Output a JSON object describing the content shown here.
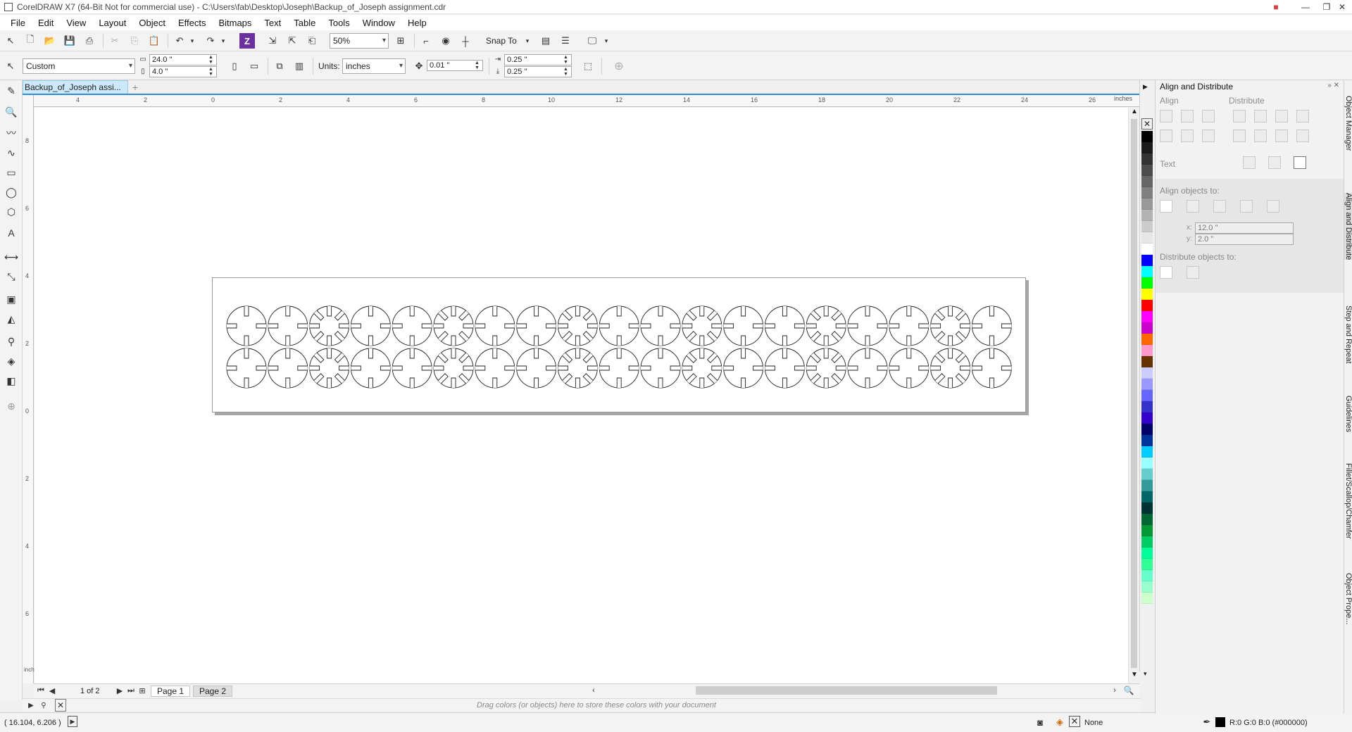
{
  "window": {
    "title": "CorelDRAW X7 (64-Bit Not for commercial use) - C:\\Users\\fab\\Desktop\\Joseph\\Backup_of_Joseph assignment.cdr",
    "minimize": "—",
    "maximize": "❐",
    "close": "✕"
  },
  "menu": [
    "File",
    "Edit",
    "View",
    "Layout",
    "Object",
    "Effects",
    "Bitmaps",
    "Text",
    "Table",
    "Tools",
    "Window",
    "Help"
  ],
  "toolbar": {
    "zoom": "50%",
    "snap_to": "Snap To"
  },
  "property_bar": {
    "page_preset": "Custom",
    "width": "24.0 \"",
    "height": "4.0 \"",
    "units_label": "Units:",
    "units_value": "inches",
    "nudge": "0.01 \"",
    "dup_x": "0.25 \"",
    "dup_y": "0.25 \""
  },
  "document_tab": "Backup_of_Joseph assi...",
  "ruler": {
    "h_labels": [
      "4",
      "2",
      "0",
      "2",
      "4",
      "6",
      "8",
      "10",
      "12",
      "14",
      "16",
      "18",
      "20",
      "22",
      "24",
      "26"
    ],
    "h_unit": "inches",
    "v_labels": [
      "8",
      "6",
      "4",
      "2",
      "0",
      "2",
      "4",
      "6"
    ],
    "v_unit": "inches"
  },
  "page_nav": {
    "counter": "1 of 2",
    "pages": [
      "Page 1",
      "Page 2"
    ]
  },
  "doc_palette_hint": "Drag colors (or objects) here to store these colors with your document",
  "status": {
    "coords": "( 16.104, 6.206 )",
    "fill_label": "None",
    "outline_label": "R:0 G:0 B:0 (#000000)"
  },
  "palette_colors": [
    "#000000",
    "#1a1a1a",
    "#333333",
    "#4d4d4d",
    "#666666",
    "#808080",
    "#999999",
    "#b3b3b3",
    "#cccccc",
    "#e6e6e6",
    "#ffffff",
    "#0000ff",
    "#00ffff",
    "#00ff00",
    "#ffff00",
    "#ff0000",
    "#ff00ff",
    "#cc00cc",
    "#ff6600",
    "#ff99cc",
    "#663300",
    "#ccccff",
    "#9999ff",
    "#6666ff",
    "#3333cc",
    "#3300cc",
    "#000066",
    "#003399",
    "#00ccff",
    "#99ffff",
    "#66cccc",
    "#339999",
    "#006666",
    "#003333",
    "#006633",
    "#009933",
    "#00cc66",
    "#00ff99",
    "#33ff99",
    "#66ffcc",
    "#99ffcc",
    "#ccffcc"
  ],
  "docker": {
    "title": "Align and Distribute",
    "align": "Align",
    "distribute": "Distribute",
    "text": "Text",
    "align_to": "Align objects to:",
    "x_label": "x:",
    "x_value": "12.0 \"",
    "y_label": "y:",
    "y_value": "2.0 \"",
    "distribute_to": "Distribute objects to:",
    "tabs": [
      "Object Manager",
      "Align and Distribute",
      "Step and Repeat",
      "Guidelines",
      "Fillet/Scallop/Chamfer",
      "Object Prope..."
    ]
  },
  "drawing": {
    "pieces_per_row": 19,
    "rows": 2,
    "pattern": [
      "plain",
      "plain",
      "cross",
      "plain",
      "plain",
      "cross"
    ]
  }
}
